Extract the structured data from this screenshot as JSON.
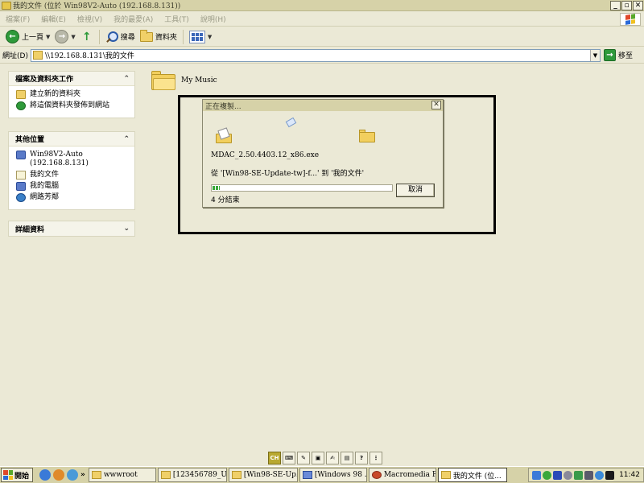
{
  "window": {
    "title": "我的文件 (位於 Win98V2-Auto (192.168.8.131))",
    "minimize_label": "_",
    "maximize_label": "▫",
    "close_label": "✕"
  },
  "menubar": {
    "items": [
      "檔案(F)",
      "編輯(E)",
      "檢視(V)",
      "我的最愛(A)",
      "工具(T)",
      "說明(H)"
    ]
  },
  "toolbar": {
    "back_label": "上一頁",
    "search_label": "搜尋",
    "folders_label": "資料夾"
  },
  "address": {
    "label": "網址(D)",
    "value": "\\\\192.168.8.131\\我的文件",
    "go_label": "移至"
  },
  "leftpane": {
    "tasks": {
      "title": "檔案及資料夾工作",
      "items": [
        "建立新的資料夾",
        "將這個資料夾發佈到網站"
      ]
    },
    "places": {
      "title": "其他位置",
      "items": [
        "Win98V2-Auto\n(192.168.8.131)",
        "我的文件",
        "我的電腦",
        "網路芳鄰"
      ]
    },
    "details": {
      "title": "詳細資料"
    },
    "collapse_glyph": "⌃",
    "expand_glyph": "⌄"
  },
  "content": {
    "folder_name": "My Music"
  },
  "dialog": {
    "title": "正在複製...",
    "close_label": "✕",
    "filename": "MDAC_2.50.4403.12_x86.exe",
    "from_to": "從 '[Win98-SE-Update-tw]-f...' 到 '我的文件'",
    "remaining": "4 分結束",
    "cancel_label": "取消",
    "progress": 0.04
  },
  "langbar": {
    "lang": "CH"
  },
  "taskbar": {
    "start_label": "開始",
    "more_label": "»",
    "tasks": [
      {
        "label": "wwwroot",
        "active": false
      },
      {
        "label": "[123456789_U...",
        "active": false
      },
      {
        "label": "[Win98-SE-Up...",
        "active": false
      },
      {
        "label": "[Windows 98 ...",
        "active": false
      },
      {
        "label": "Macromedia Fi...",
        "active": false
      },
      {
        "label": "我的文件 (位...",
        "active": true
      }
    ],
    "clock": "11:42"
  }
}
